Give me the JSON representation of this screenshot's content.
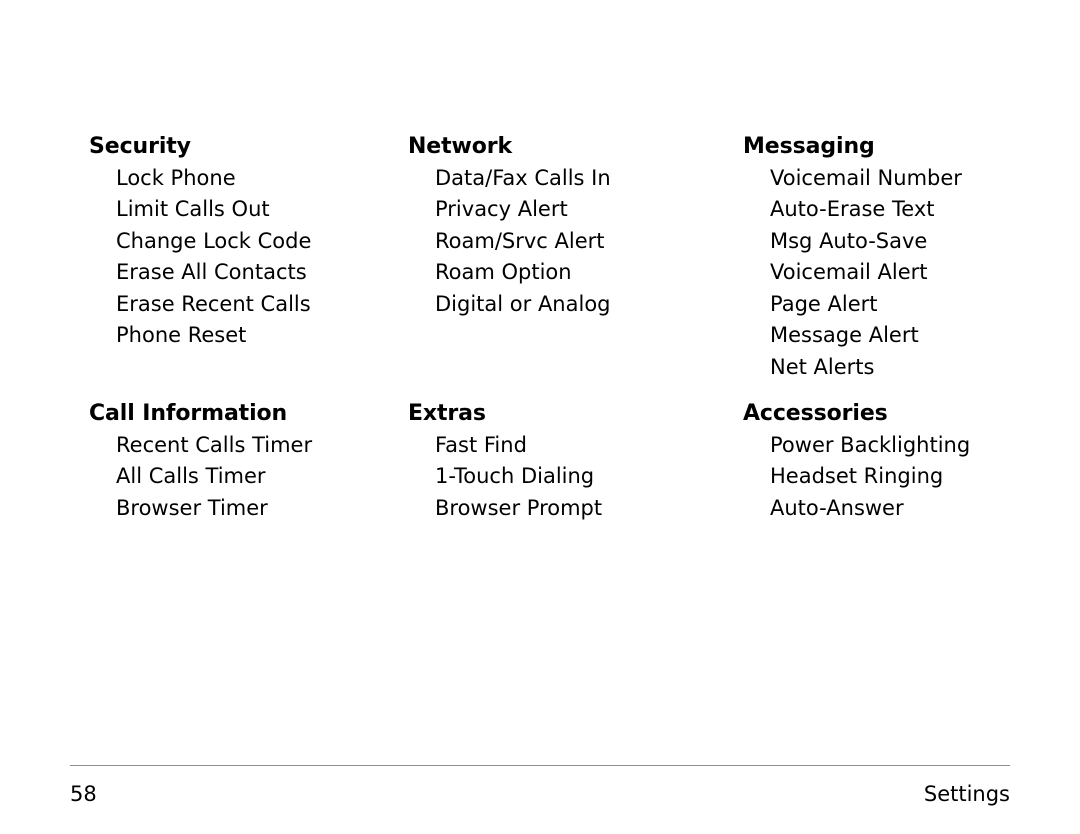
{
  "page": {
    "background_color": "#ffffff",
    "text_color": "#000000",
    "rule_color": "#8d8d8d"
  },
  "sections": [
    {
      "title": "Security",
      "items": [
        "Lock Phone",
        "Limit Calls Out",
        "Change Lock Code",
        "Erase All Contacts",
        "Erase Recent Calls",
        "Phone Reset"
      ]
    },
    {
      "title": "Network",
      "items": [
        "Data/Fax Calls In",
        "Privacy Alert",
        "Roam/Srvc Alert",
        "Roam Option",
        "Digital or Analog"
      ]
    },
    {
      "title": "Messaging",
      "items": [
        "Voicemail Number",
        "Auto-Erase Text",
        "Msg Auto-Save",
        "Voicemail Alert",
        "Page Alert",
        "Message Alert",
        "Net Alerts"
      ]
    },
    {
      "title": "Call Information",
      "items": [
        "Recent Calls Timer",
        "All Calls Timer",
        "Browser Timer"
      ]
    },
    {
      "title": "Extras",
      "items": [
        "Fast Find",
        "1-Touch Dialing",
        "Browser Prompt"
      ]
    },
    {
      "title": "Accessories",
      "items": [
        "Power Backlighting",
        "Headset Ringing",
        "Auto-Answer"
      ]
    }
  ],
  "footer": {
    "page_number": "58",
    "label": "Settings"
  }
}
